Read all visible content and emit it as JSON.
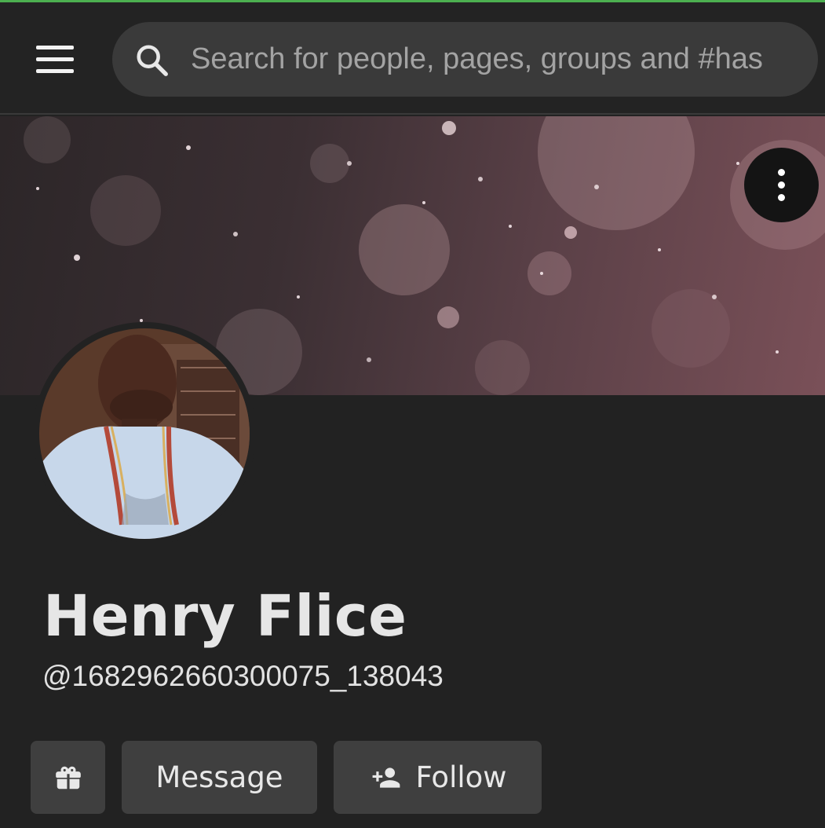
{
  "header": {
    "search": {
      "placeholder": "Search for people, pages, groups and #has"
    }
  },
  "profile": {
    "name": "Henry Flice",
    "handle": "@1682962660300075_138043"
  },
  "actions": {
    "message_label": "Message",
    "follow_label": "Follow"
  },
  "icons": {
    "menu": "hamburger-menu-icon",
    "search": "search-icon",
    "more": "more-vertical-icon",
    "gift": "gift-icon",
    "follow": "person-add-icon"
  },
  "colors": {
    "background": "#222222",
    "search_bg": "#3a3a3a",
    "button_bg": "#3f3f3f",
    "top_accent": "#4caf50"
  }
}
